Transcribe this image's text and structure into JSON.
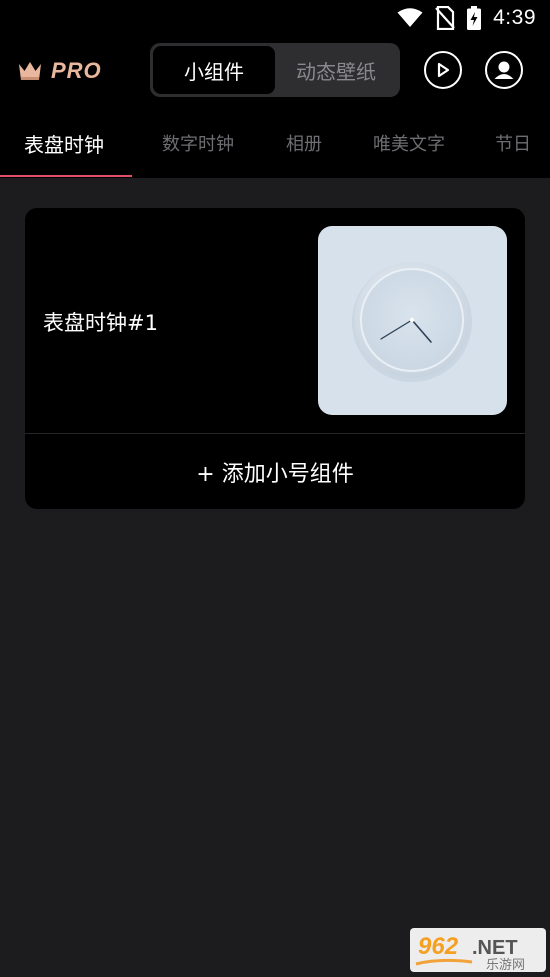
{
  "status_bar": {
    "time": "4:39",
    "icons": [
      "wifi-icon",
      "no-sim-icon",
      "battery-charging-icon"
    ]
  },
  "header": {
    "logo_text": "PRO",
    "logo_icon": "crown-icon",
    "segments": [
      {
        "label": "小组件",
        "active": true
      },
      {
        "label": "动态壁纸",
        "active": false
      }
    ],
    "play_icon": "play-circle-icon",
    "profile_icon": "user-circle-icon"
  },
  "tabs": [
    {
      "label": "表盘时钟",
      "active": true
    },
    {
      "label": "数字时钟",
      "active": false
    },
    {
      "label": "相册",
      "active": false
    },
    {
      "label": "唯美文字",
      "active": false
    },
    {
      "label": "节日",
      "active": false
    }
  ],
  "card": {
    "title": "表盘时钟#1",
    "add_label": "+ 添加小号组件"
  },
  "watermark": {
    "main": "962.NET",
    "sub": "乐游网"
  },
  "colors": {
    "background": "#1c1c1e",
    "bar": "#000000",
    "accent": "#e0506a",
    "logo": "#e9b79d",
    "preview_bg": "#d7e1ec"
  }
}
